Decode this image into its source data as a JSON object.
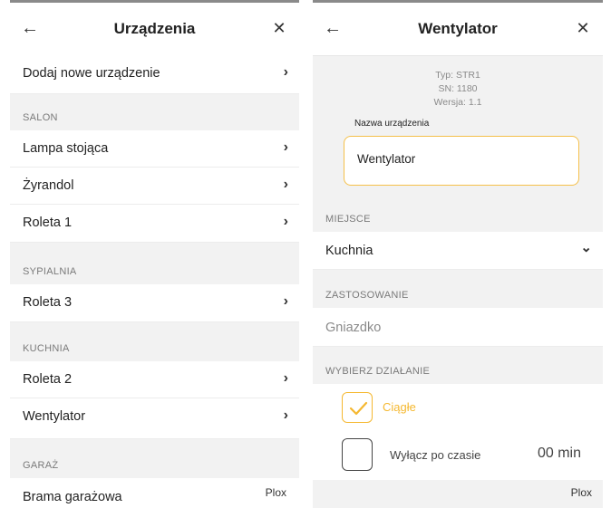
{
  "left": {
    "title": "Urządzenia",
    "back_icon": "←",
    "close_icon": "✕",
    "add_label": "Dodaj nowe urządzenie",
    "chevron": "›",
    "sections": [
      {
        "name": "SALON",
        "items": [
          "Lampa stojąca",
          "Żyrandol",
          "Roleta 1"
        ]
      },
      {
        "name": "SYPIALNIA",
        "items": [
          "Roleta 3"
        ]
      },
      {
        "name": "KUCHNIA",
        "items": [
          "Roleta 2",
          "Wentylator"
        ]
      },
      {
        "name": "GARAŻ",
        "items": [
          "Brama garażowa"
        ]
      }
    ],
    "footer_brand": "Plox"
  },
  "right": {
    "title": "Wentylator",
    "back_icon": "←",
    "close_icon": "✕",
    "info": {
      "type": "Typ: STR1",
      "sn": "SN: 1180",
      "version": "Wersja: 1.1"
    },
    "name_label": "Nazwa urządzenia",
    "name_value": "Wentylator",
    "place_section": "MIEJSCE",
    "place_value": "Kuchnia",
    "place_chevron": "⌄",
    "usage_section": "ZASTOSOWANIE",
    "usage_value": "Gniazdko",
    "action_section": "WYBIERZ DZIAŁANIE",
    "option_continuous": "Ciągłe",
    "option_timer": "Wyłącz po czasie",
    "timer_value": "00 min",
    "footer_brand": "Plox"
  },
  "colors": {
    "accent": "#f5b830",
    "section_bg": "#f2f2f2",
    "muted": "#8a8a8a"
  }
}
